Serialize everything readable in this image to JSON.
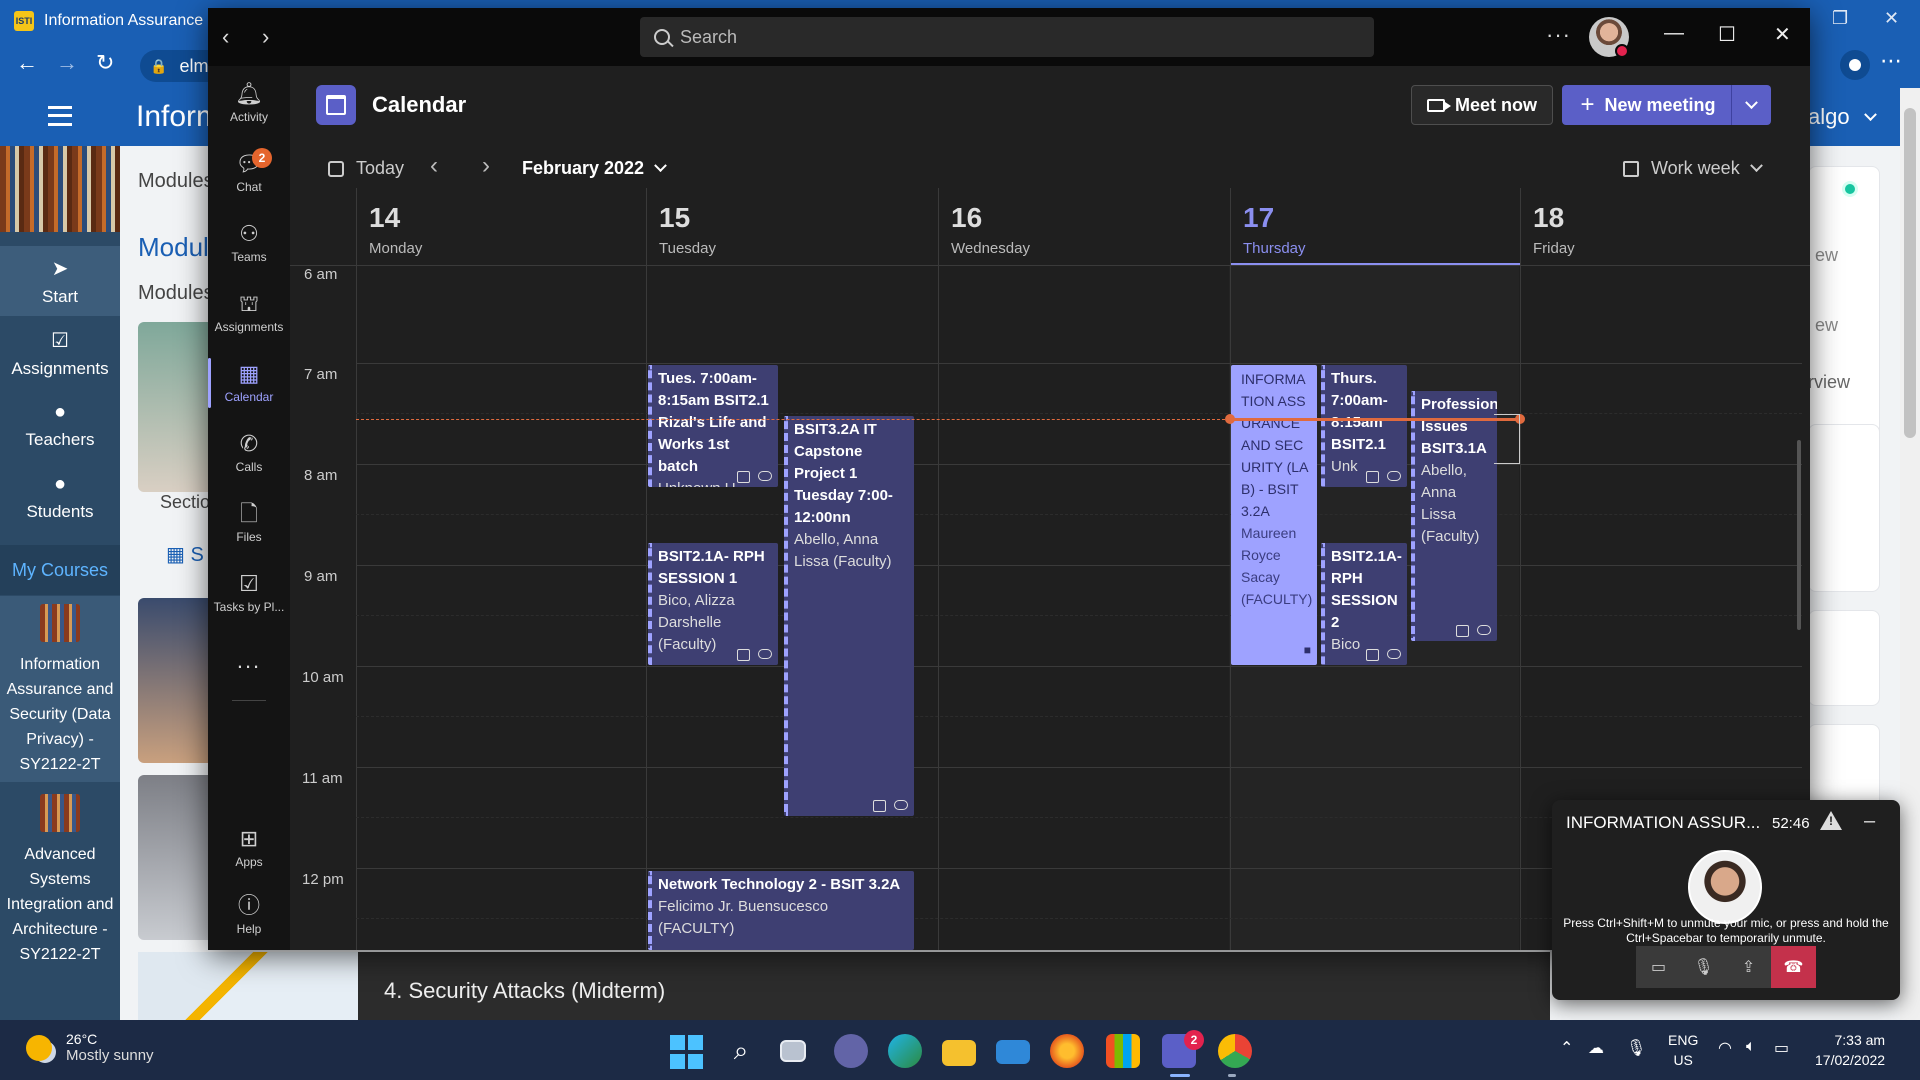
{
  "browser": {
    "tab_title": "Information Assurance",
    "favicon": "ISTI",
    "url": "elm"
  },
  "lms": {
    "header_title": "Inform",
    "user": "algo",
    "nav": [
      {
        "icon": "navigation-arrow-icon",
        "label": "Start"
      },
      {
        "icon": "assignments-check-icon",
        "label": "Assignments"
      },
      {
        "icon": "person-icon",
        "label": "Teachers"
      },
      {
        "icon": "person-icon",
        "label": "Students"
      }
    ],
    "my_courses": "My Courses",
    "courses": [
      {
        "label": "Information Assurance and Security (Data Privacy) - SY2122-2T"
      },
      {
        "label": "Advanced Systems Integration and Architecture - SY2122-2T"
      }
    ],
    "modules_tab": "Modules",
    "modules_heading": "Modul",
    "modules_sub": "Modules",
    "section_label": "Sectio",
    "link_text": "S",
    "right_text_1": "ew",
    "right_text_2": "rview",
    "strip_text": "4. Security Attacks (Midterm)"
  },
  "teams": {
    "search_placeholder": "Search",
    "rail": [
      {
        "icon": "bell-icon",
        "label": "Activity"
      },
      {
        "icon": "chat-icon",
        "label": "Chat",
        "badge": "2"
      },
      {
        "icon": "teams-icon",
        "label": "Teams"
      },
      {
        "icon": "backpack-icon",
        "label": "Assignments"
      },
      {
        "icon": "calendar-icon",
        "label": "Calendar"
      },
      {
        "icon": "phone-icon",
        "label": "Calls"
      },
      {
        "icon": "file-icon",
        "label": "Files"
      },
      {
        "icon": "tasks-icon",
        "label": "Tasks by Pl..."
      },
      {
        "icon": "apps-icon",
        "label": "Apps"
      },
      {
        "icon": "help-icon",
        "label": "Help"
      }
    ],
    "more": "...",
    "calendar": {
      "title": "Calendar",
      "meet_now": "Meet now",
      "new_meeting": "New meeting",
      "today": "Today",
      "month": "February 2022",
      "view": "Work week",
      "days": [
        {
          "num": "14",
          "name": "Monday"
        },
        {
          "num": "15",
          "name": "Tuesday"
        },
        {
          "num": "16",
          "name": "Wednesday"
        },
        {
          "num": "17",
          "name": "Thursday",
          "today": true
        },
        {
          "num": "18",
          "name": "Friday"
        }
      ],
      "hours": [
        "6 am",
        "7 am",
        "8 am",
        "9 am",
        "10 am",
        "11 am",
        "12 pm"
      ],
      "events": [
        {
          "title": "Tues. 7:00am-8:15am BSIT2.1 Rizal's Life and Works 1st batch",
          "sub": "Unknown U"
        },
        {
          "title": "BSIT3.2A IT Capstone Project 1 Tuesday 7:00-12:00nn",
          "sub": "Abello, Anna Lissa (Faculty)"
        },
        {
          "title": "BSIT2.1A- RPH SESSION 1",
          "sub": "Bico, Alizza Darshelle (Faculty)"
        },
        {
          "title": "Network Technology 2 - BSIT 3.2A",
          "sub": "Felicimo Jr. Buensucesco (FACULTY)"
        },
        {
          "title": "INFORMATION ASSURANCE AND SECURITY (LAB) - BSIT 3.2A",
          "sub": "Maureen Royce Sacay (FACULTY)"
        },
        {
          "title": "Thurs. 7:00am-8:15am BSIT2.1",
          "sub": "Unk"
        },
        {
          "title": "BSIT2.1A- RPH SESSION 2",
          "sub": "Bico"
        },
        {
          "title": "Profession Issues BSIT3.1A",
          "sub": "Abello, Anna Lissa (Faculty)"
        }
      ]
    },
    "call": {
      "title": "INFORMATION ASSUR...",
      "timer": "52:46",
      "message": "Press Ctrl+Shift+M to unmute your mic, or press and hold the Ctrl+Spacebar to temporarily unmute."
    }
  },
  "taskbar": {
    "temp": "26°C",
    "weather": "Mostly sunny",
    "lang1": "ENG",
    "lang2": "US",
    "time": "7:33 am",
    "date": "17/02/2022",
    "teams_badge": "2"
  }
}
